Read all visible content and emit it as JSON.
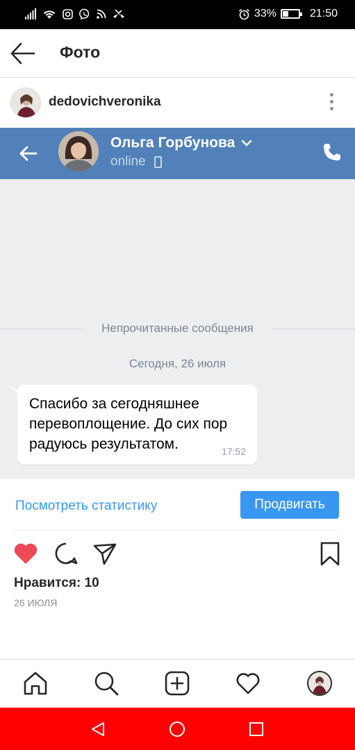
{
  "status_bar": {
    "battery": "33%",
    "battery_level": 0.33,
    "time": "21:50"
  },
  "header": {
    "title": "Фото",
    "back_icon": "arrow-left-icon"
  },
  "post": {
    "username": "dedovichveronika",
    "more_icon": "more-vertical-icon",
    "likes": "Нравится: 10",
    "date": "26 ИЮЛЯ"
  },
  "vk": {
    "contact_name": "Ольга Горбунова",
    "status": "online",
    "unread_divider": "Непрочитанные сообщения",
    "date_label": "Сегодня, 26 июля",
    "message_text": "Спасибо за сегодняшнее перевоплощение. До сих пор радуюсь результатом.",
    "message_time": "17:52",
    "header_color": "#5181b8",
    "chat_background": "#edeef0"
  },
  "insights": {
    "link_label": "Посмотреть статистику",
    "promote_label": "Продвигать"
  },
  "colors": {
    "accent": "#3897f0",
    "like": "#ed4956",
    "android_nav": "#ff0000"
  }
}
